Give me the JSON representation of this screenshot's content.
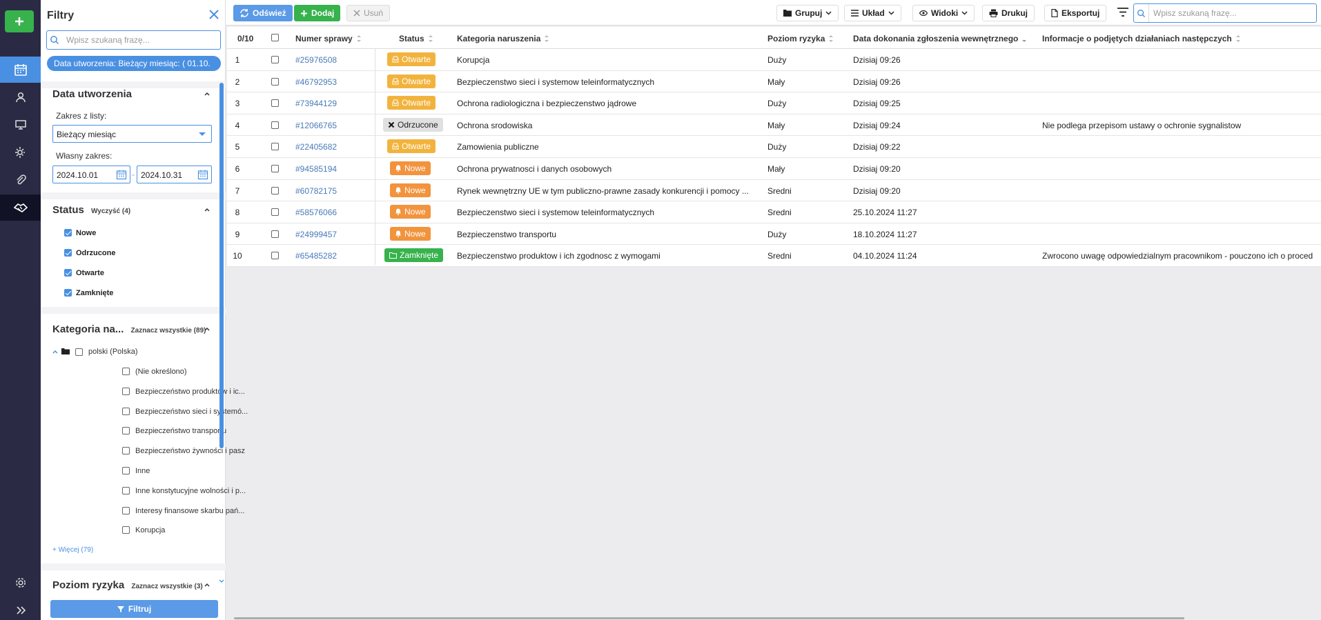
{
  "rail": {
    "items": [
      {
        "icon": "calendar-icon",
        "active": true
      },
      {
        "icon": "user-icon"
      },
      {
        "icon": "monitor-icon"
      },
      {
        "icon": "gear-shield-icon"
      },
      {
        "icon": "paperclip-icon"
      },
      {
        "icon": "handshake-icon",
        "dark": true
      }
    ],
    "bottom": [
      {
        "icon": "settings-icon"
      },
      {
        "icon": "expand-icon"
      }
    ]
  },
  "filters": {
    "title": "Filtry",
    "search_placeholder": "Wpisz szukaną frazę...",
    "active_chip": "Data utworzenia: Bieżący miesiąc: ( 01.10.",
    "date_section": {
      "title": "Data utworzenia",
      "range_label": "Zakres z listy:",
      "range_value": "Bieżący miesiąc",
      "custom_label": "Własny zakres:",
      "from": "2024.10.01",
      "to": "2024.10.31",
      "separator": "-"
    },
    "status_section": {
      "title": "Status",
      "clear_link": "Wyczyść (4)",
      "items": [
        {
          "label": "Nowe",
          "checked": true
        },
        {
          "label": "Odrzucone",
          "checked": true
        },
        {
          "label": "Otwarte",
          "checked": true
        },
        {
          "label": "Zamknięte",
          "checked": true
        }
      ]
    },
    "category_section": {
      "title": "Kategoria na...",
      "select_all": "Zaznacz wszystkie (89)",
      "root": "polski (Polska)",
      "items": [
        "(Nie określono)",
        "Bezpieczeństwo produktów i ic...",
        "Bezpieczeństwo sieci i systemó...",
        "Bezpieczeństwo transportu",
        "Bezpieczeństwo żywności i pasz",
        "Inne",
        "Inne konstytucyjne wolności i p...",
        "Interesy finansowe skarbu pań...",
        "Korupcja"
      ],
      "more": "+ Więcej (79)"
    },
    "risk_section": {
      "title": "Poziom ryzyka",
      "select_all": "Zaznacz wszystkie (3)"
    },
    "apply_button": "Filtruj"
  },
  "toolbar": {
    "refresh": "Odśwież",
    "add": "Dodaj",
    "delete": "Usuń",
    "group": "Grupuj",
    "layout": "Układ",
    "views": "Widoki",
    "print": "Drukuj",
    "export": "Eksportuj",
    "search_placeholder": "Wpisz szukaną frazę..."
  },
  "table": {
    "selection_count": "0/10",
    "columns": {
      "case_number": "Numer sprawy",
      "status": "Status",
      "category": "Kategoria naruszenia",
      "risk": "Poziom ryzyka",
      "date": "Data dokonania zgłoszenia wewnętrznego",
      "info": "Informacje o podjętych działaniach następczych"
    },
    "rows": [
      {
        "n": "1",
        "case": "#25976508",
        "status": "Otwarte",
        "status_type": "otwarte",
        "category": "Korupcja",
        "risk": "Duży",
        "date": "Dzisiaj 09:26",
        "info": ""
      },
      {
        "n": "2",
        "case": "#46792953",
        "status": "Otwarte",
        "status_type": "otwarte",
        "category": "Bezpieczenstwo sieci i systemow teleinformatycznych",
        "risk": "Mały",
        "date": "Dzisiaj 09:26",
        "info": ""
      },
      {
        "n": "3",
        "case": "#73944129",
        "status": "Otwarte",
        "status_type": "otwarte",
        "category": "Ochrona radiologiczna i bezpieczenstwo jądrowe",
        "risk": "Duży",
        "date": "Dzisiaj 09:25",
        "info": ""
      },
      {
        "n": "4",
        "case": "#12066765",
        "status": "Odrzucone",
        "status_type": "odrzucone",
        "category": "Ochrona srodowiska",
        "risk": "Mały",
        "date": "Dzisiaj 09:24",
        "info": "Nie podlega przepisom ustawy o ochronie sygnalistow"
      },
      {
        "n": "5",
        "case": "#22405682",
        "status": "Otwarte",
        "status_type": "otwarte",
        "category": "Zamowienia publiczne",
        "risk": "Duży",
        "date": "Dzisiaj 09:22",
        "info": ""
      },
      {
        "n": "6",
        "case": "#94585194",
        "status": "Nowe",
        "status_type": "nowe",
        "category": "Ochrona prywatnosci i danych osobowych",
        "risk": "Mały",
        "date": "Dzisiaj 09:20",
        "info": ""
      },
      {
        "n": "7",
        "case": "#60782175",
        "status": "Nowe",
        "status_type": "nowe",
        "category": "Rynek wewnętrzny UE w tym publiczno-prawne zasady konkurencji i pomocy ...",
        "risk": "Sredni",
        "date": "Dzisiaj 09:20",
        "info": ""
      },
      {
        "n": "8",
        "case": "#58576066",
        "status": "Nowe",
        "status_type": "nowe",
        "category": "Bezpieczenstwo sieci i systemow teleinformatycznych",
        "risk": "Sredni",
        "date": "25.10.2024 11:27",
        "info": ""
      },
      {
        "n": "9",
        "case": "#24999457",
        "status": "Nowe",
        "status_type": "nowe",
        "category": "Bezpieczenstwo transportu",
        "risk": "Duży",
        "date": "18.10.2024 11:27",
        "info": ""
      },
      {
        "n": "10",
        "case": "#65485282",
        "status": "Zamknięte",
        "status_type": "zamkniete",
        "category": "Bezpieczenstwo produktow i ich zgodnosc z wymogami",
        "risk": "Sredni",
        "date": "04.10.2024 11:24",
        "info": "Zwrocono uwagę odpowiedzialnym pracownikom - pouczono ich o proced"
      }
    ]
  },
  "colors": {
    "accent": "#4a90e2",
    "green": "#37b24d",
    "rail": "#2a2a44",
    "otwarte": "#f2b33d",
    "nowe": "#f2933d"
  }
}
